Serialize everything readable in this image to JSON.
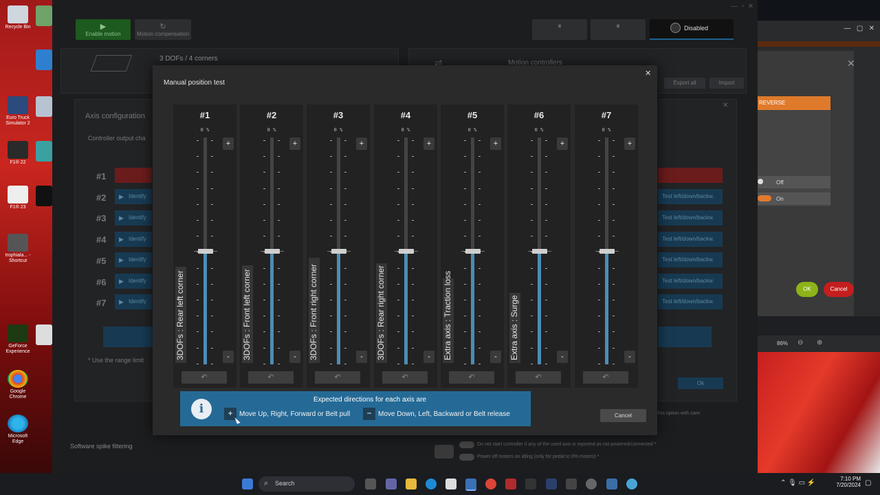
{
  "desktop": {
    "icons": [
      {
        "label": "Recycle Bin"
      },
      {
        "label": "Euro Truck Simulator 2"
      },
      {
        "label": "F1® 22"
      },
      {
        "label": "F1® 23"
      },
      {
        "label": "trophiala... - Shortcut"
      },
      {
        "label": "GeForce Experience"
      },
      {
        "label": "Google Chrome"
      },
      {
        "label": "Microsoft Edge"
      }
    ]
  },
  "app": {
    "toolbar": {
      "enable_motion": "Enable motion",
      "motion_compensation": "Motion compensation",
      "status": "Disabled"
    },
    "dofs_label": "3 DOFs / 4 corners",
    "motion_controllers": "Motion controllers",
    "export_all": "Export all",
    "import": "Import",
    "axis_config_title": "Axis configuration",
    "controller_output": "Controller output cha",
    "rows": [
      "#1",
      "#2",
      "#3",
      "#4",
      "#5",
      "#6",
      "#7"
    ],
    "identify": "Identify",
    "test_label": "Test left/down/backw.",
    "range_note": "* Use the range limit",
    "ok_label": "Ok",
    "this_option": "this option with care.",
    "spike_filtering": "Software spike filtering",
    "opt1": "Do not start controller if any of the used axis is reported as not powered/connected *",
    "opt2": "Power off motors on idling (only for pedal to 0% motors) *"
  },
  "right_window": {
    "reverse": "REVERSE",
    "off": "Off",
    "on": "On",
    "ok": "OK",
    "cancel": "Cancel",
    "zoom": "86%"
  },
  "dialog": {
    "title": "Manual position test",
    "axes": [
      {
        "num": "#1",
        "percent": "0 %",
        "label": "3DOFs : Rear left corner",
        "level": 0.5
      },
      {
        "num": "#2",
        "percent": "0 %",
        "label": "3DOFs : Front left corner",
        "level": 0.5
      },
      {
        "num": "#3",
        "percent": "0 %",
        "label": "3DOFs : Front right corner",
        "level": 0.5
      },
      {
        "num": "#4",
        "percent": "0 %",
        "label": "3DOFs : Rear right corner",
        "level": 0.5
      },
      {
        "num": "#5",
        "percent": "0 %",
        "label": "Extra axis : Traction loss",
        "level": 0.5
      },
      {
        "num": "#6",
        "percent": "0 %",
        "label": "Extra axis : Surge",
        "level": 0.5
      },
      {
        "num": "#7",
        "percent": "0 %",
        "label": "",
        "level": 0.5
      }
    ],
    "plus": "+",
    "minus": "-",
    "info": {
      "title": "Expected directions for each axis are",
      "plus_text": "Move Up, Right, Forward or Belt pull",
      "minus_text": "Move Down, Left, Backward or Belt release"
    },
    "cancel": "Cancel"
  },
  "taskbar": {
    "search": "Search",
    "time": "7:10 PM",
    "date": "7/20/2024"
  }
}
